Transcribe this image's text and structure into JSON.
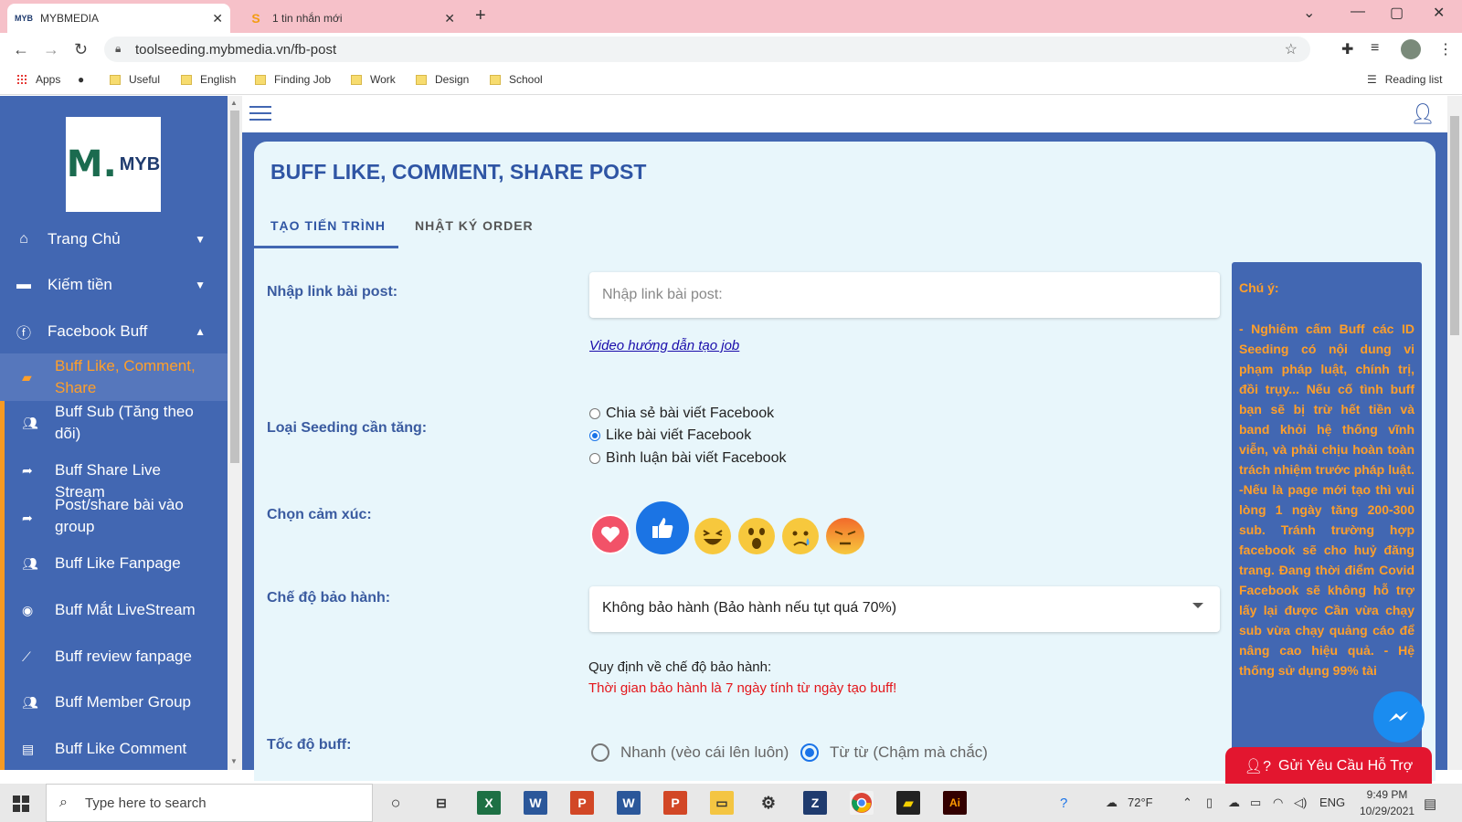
{
  "browser": {
    "tabs": [
      {
        "title": "MYBMEDIA",
        "favicon": "MYB"
      },
      {
        "title": "1 tin nhắn mới",
        "favicon": "S"
      }
    ],
    "url": "toolseeding.mybmedia.vn/fb-post",
    "bookmarks": [
      "Apps",
      "Useful",
      "English",
      "Finding Job",
      "Work",
      "Design",
      "School"
    ],
    "reading_list": "Reading list"
  },
  "sidebar": {
    "logo": {
      "mark": "M.",
      "text": "MYB"
    },
    "menu": [
      {
        "label": "Trang Chủ",
        "icon": "home-icon"
      },
      {
        "label": "Kiếm tiền",
        "icon": "wallet-icon"
      },
      {
        "label": "Facebook Buff",
        "icon": "facebook-icon"
      }
    ],
    "sub_items": [
      {
        "label": "Buff Like, Comment, Share",
        "icon": "comment-icon"
      },
      {
        "label": "Buff Sub (Tăng theo dõi)",
        "icon": "users-icon"
      },
      {
        "label": "Buff Share Live Stream",
        "icon": "share-icon"
      },
      {
        "label": "Post/share bài vào group",
        "icon": "share-icon"
      },
      {
        "label": "Buff Like Fanpage",
        "icon": "users-icon"
      },
      {
        "label": "Buff Mắt LiveStream",
        "icon": "eye-icon"
      },
      {
        "label": "Buff review fanpage",
        "icon": "trend-icon"
      },
      {
        "label": "Buff Member Group",
        "icon": "users-icon"
      },
      {
        "label": "Buff Like Comment",
        "icon": "comments-icon"
      }
    ]
  },
  "page": {
    "title": "BUFF LIKE, COMMENT, SHARE POST",
    "tabs": [
      "TẠO TIẾN TRÌNH",
      "NHẬT KÝ ORDER"
    ],
    "form": {
      "link_label": "Nhập link bài post:",
      "link_placeholder": "Nhập link bài post:",
      "video_link": "Video hướng dẫn tạo job",
      "seeding_label": "Loại Seeding cần tăng:",
      "seeding_options": [
        "Chia sẻ bài viết Facebook",
        "Like bài viết Facebook",
        "Bình luận bài viết Facebook"
      ],
      "seeding_selected": 1,
      "emotion_label": "Chọn cảm xúc:",
      "warranty_label": "Chế độ bảo hành:",
      "warranty_value": "Không bảo hành (Bảo hành nếu tụt quá 70%)",
      "warranty_rule_title": "Quy định về chế độ bảo hành:",
      "warranty_rule_text": "Thời gian bảo hành là 7 ngày tính từ ngày tạo buff!",
      "speed_label": "Tốc độ buff:",
      "speed_options": [
        "Nhanh (vèo cái lên luôn)",
        "Từ từ (Chậm mà chắc)"
      ],
      "speed_selected": 1
    },
    "note": {
      "title": "Chú ý:",
      "body": "- Nghiêm cấm Buff các ID Seeding có nội dung vi phạm pháp luật, chính trị, đồi trụy... Nếu cố tình buff bạn sẽ bị trừ hết tiền và band khỏi hệ thống vĩnh viễn, và phải chịu hoàn toàn trách nhiệm trước pháp luật. -Nếu là page mới tạo thì vui lòng 1 ngày tăng 200-300 sub. Tránh trường hợp facebook sẽ cho huỷ đăng trang. Đang thời điểm Covid Facebook sẽ không hỗ trợ lấy lại được Cần vừa chạy sub vừa chạy quảng cáo để nâng cao hiệu quả. - Hệ thống sử dụng 99% tài"
    },
    "support_button": "Gửi Yêu Cầu Hỗ Trợ"
  },
  "taskbar": {
    "search_placeholder": "Type here to search",
    "weather": "72°F",
    "lang": "ENG",
    "time": "9:49 PM",
    "date": "10/29/2021"
  }
}
